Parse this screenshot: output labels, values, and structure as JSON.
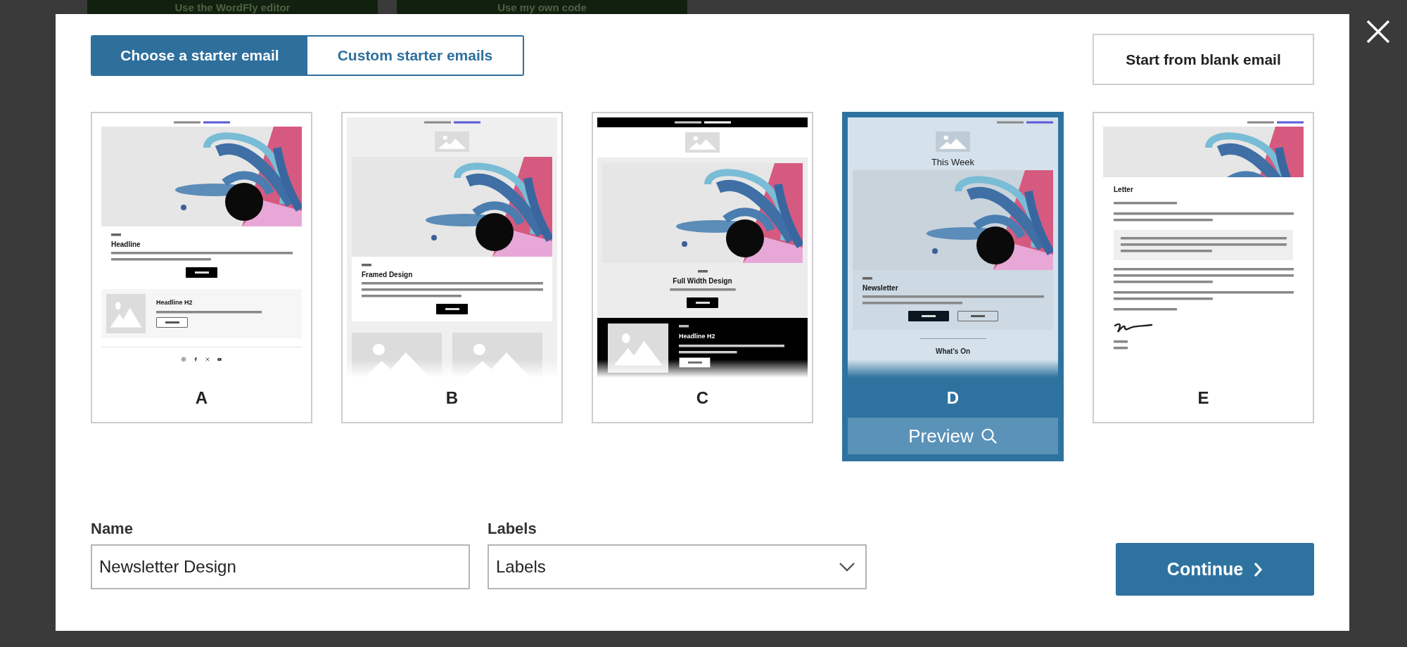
{
  "background": {
    "buttons": [
      {
        "label": "Use the WordFly editor"
      },
      {
        "label": "Use my own code"
      }
    ]
  },
  "modal": {
    "tabs": [
      {
        "label": "Choose a starter email",
        "selected": true
      },
      {
        "label": "Custom starter emails",
        "selected": false
      }
    ],
    "blank_button": "Start from blank email",
    "designs": [
      {
        "letter": "A",
        "kind": "padded",
        "selected": false,
        "blocks": [
          {
            "kind": "preheader"
          },
          {
            "kind": "hero"
          },
          {
            "kind": "article",
            "headline": "Headline",
            "buttons": [
              {
                "kind": "solid"
              }
            ]
          },
          {
            "kind": "media_row",
            "headline": "Headline H2"
          },
          {
            "kind": "divider"
          },
          {
            "kind": "social"
          }
        ]
      },
      {
        "letter": "B",
        "kind": "framed",
        "selected": false,
        "blocks": [
          {
            "kind": "preheader"
          },
          {
            "kind": "logo"
          },
          {
            "kind": "hero"
          },
          {
            "kind": "article",
            "headline": "Framed Design",
            "buttons": [
              {
                "kind": "solid"
              }
            ]
          },
          {
            "kind": "image_pair"
          }
        ]
      },
      {
        "letter": "C",
        "kind": "full_width",
        "selected": false,
        "blocks": [
          {
            "kind": "preheader"
          },
          {
            "kind": "logo"
          },
          {
            "kind": "hero"
          },
          {
            "kind": "article",
            "headline": "Full Width Design",
            "buttons": [
              {
                "kind": "solid"
              }
            ]
          },
          {
            "kind": "media_row",
            "headline": "Headline H2"
          }
        ]
      },
      {
        "letter": "D",
        "kind": "newsletter",
        "selected": true,
        "blocks": [
          {
            "kind": "preheader"
          },
          {
            "kind": "logo"
          },
          {
            "kind": "title",
            "text": "This Week"
          },
          {
            "kind": "hero"
          },
          {
            "kind": "article",
            "headline": "Newsletter",
            "buttons": [
              {
                "kind": "solid"
              },
              {
                "kind": "outline"
              }
            ]
          },
          {
            "kind": "section_heading",
            "text": "What's On"
          }
        ]
      },
      {
        "letter": "E",
        "kind": "letter",
        "selected": false,
        "blocks": [
          {
            "kind": "preheader"
          },
          {
            "kind": "hero"
          },
          {
            "kind": "heading",
            "text": "Letter"
          },
          {
            "kind": "line"
          },
          {
            "kind": "paragraph"
          },
          {
            "kind": "callout"
          },
          {
            "kind": "long_paragraph"
          },
          {
            "kind": "paragraph"
          },
          {
            "kind": "line"
          },
          {
            "kind": "signature"
          },
          {
            "kind": "signoff"
          }
        ]
      }
    ],
    "preview_button": "Preview",
    "name_field": {
      "label": "Name",
      "value": "Newsletter Design"
    },
    "labels_field": {
      "label": "Labels",
      "placeholder": "Labels"
    },
    "continue_button": "Continue"
  }
}
